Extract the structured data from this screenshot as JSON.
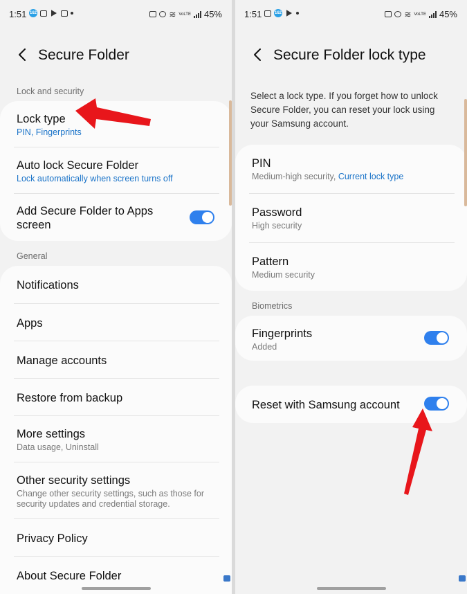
{
  "status": {
    "time": "1:51",
    "battery": "45%",
    "volte_label": "VoLTE"
  },
  "left_screen": {
    "title": "Secure Folder",
    "lock_section_label": "Lock and security",
    "lock_type": {
      "title": "Lock type",
      "subtitle": "PIN, Fingerprints"
    },
    "auto_lock": {
      "title": "Auto lock Secure Folder",
      "subtitle": "Lock automatically when screen turns off"
    },
    "add_to_apps": {
      "title": "Add Secure Folder to Apps screen",
      "enabled": true
    },
    "general_label": "General",
    "general_items": [
      {
        "title": "Notifications",
        "subtitle": ""
      },
      {
        "title": "Apps",
        "subtitle": ""
      },
      {
        "title": "Manage accounts",
        "subtitle": ""
      },
      {
        "title": "Restore from backup",
        "subtitle": ""
      },
      {
        "title": "More settings",
        "subtitle": "Data usage, Uninstall"
      },
      {
        "title": "Other security settings",
        "subtitle": "Change other security settings, such as those for security updates and credential storage."
      },
      {
        "title": "Privacy Policy",
        "subtitle": ""
      },
      {
        "title": "About Secure Folder",
        "subtitle": ""
      }
    ]
  },
  "right_screen": {
    "title": "Secure Folder lock type",
    "description": "Select a lock type. If you forget how to unlock Secure Folder, you can reset your lock using your Samsung account.",
    "lock_options": [
      {
        "title": "PIN",
        "subtitle": "Medium-high security, ",
        "subtitle_highlight": "Current lock type"
      },
      {
        "title": "Password",
        "subtitle": "High security"
      },
      {
        "title": "Pattern",
        "subtitle": "Medium security"
      }
    ],
    "biometrics_label": "Biometrics",
    "fingerprints": {
      "title": "Fingerprints",
      "subtitle": "Added",
      "enabled": true
    },
    "reset_samsung": {
      "title": "Reset with Samsung account",
      "enabled": true
    }
  },
  "colors": {
    "accent_blue": "#1a73c8",
    "toggle_on": "#2f80ed",
    "annotation_arrow": "#e8161b"
  }
}
